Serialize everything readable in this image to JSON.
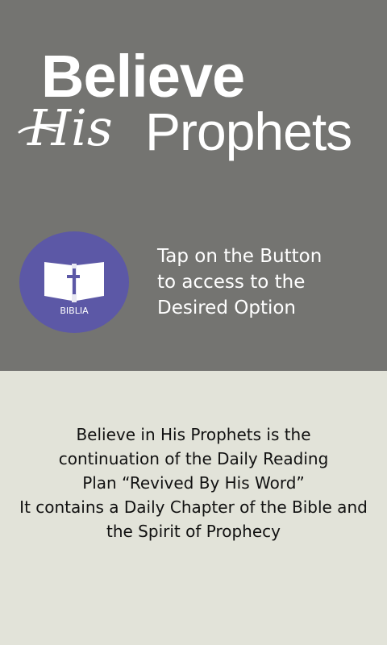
{
  "logo": {
    "word1": "Believe",
    "word2": "His",
    "word3": "Prophets"
  },
  "bible_button": {
    "label": "BIBLIA",
    "icon": "open-bible-cross-icon",
    "color": "#5c58a6"
  },
  "instructions": [
    "Tap on the Button",
    "to access to the",
    "Desired Option"
  ],
  "description": [
    "Believe in His Prophets is the",
    "continuation of the Daily Reading",
    "Plan “Revived By His Word”",
    "It contains a Daily Chapter of the Bible and",
    "the Spirit of Prophecy"
  ],
  "colors": {
    "header_bg": "#747471",
    "body_bg": "#e2e3d9"
  }
}
